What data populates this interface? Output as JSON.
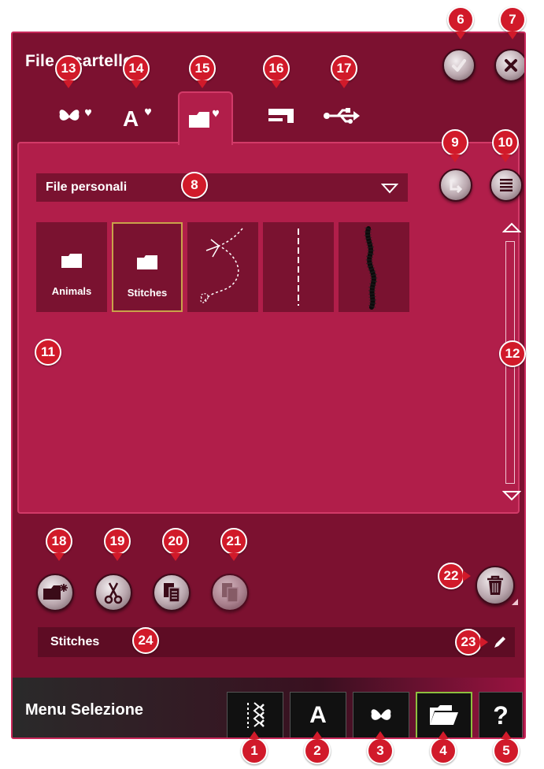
{
  "window": {
    "title": "File e cartelle"
  },
  "header": {
    "confirm_icon": "check-icon",
    "close_icon": "close-icon"
  },
  "tabs": [
    {
      "icon": "butterfly-heart-icon"
    },
    {
      "icon": "font-heart-icon"
    },
    {
      "icon": "folder-heart-icon",
      "active": true
    },
    {
      "icon": "machine-icon"
    },
    {
      "icon": "usb-icon"
    }
  ],
  "browser": {
    "dropdown_value": "File personali",
    "tiles": [
      {
        "type": "folder",
        "label": "Animals"
      },
      {
        "type": "folder",
        "label": "Stitches",
        "selected": true
      },
      {
        "type": "stitch",
        "label": ""
      },
      {
        "type": "stitch",
        "label": ""
      },
      {
        "type": "stitch",
        "label": ""
      }
    ]
  },
  "actions": {
    "new_folder_icon": "new-folder-icon",
    "cut_icon": "scissors-icon",
    "copy_icon": "copy-icon",
    "paste_icon": "paste-icon",
    "delete_icon": "trash-icon"
  },
  "name_field": {
    "value": "Stitches"
  },
  "bottom_bar": {
    "label": "Menu Selezione",
    "buttons": [
      {
        "icon": "stitch-icon"
      },
      {
        "text": "A"
      },
      {
        "icon": "butterfly-icon"
      },
      {
        "icon": "folder-open-icon",
        "active": true
      },
      {
        "text": "?"
      }
    ]
  },
  "callouts": [
    "1",
    "2",
    "3",
    "4",
    "5",
    "6",
    "7",
    "8",
    "9",
    "10",
    "11",
    "12",
    "13",
    "14",
    "15",
    "16",
    "17",
    "18",
    "19",
    "20",
    "21",
    "22",
    "23",
    "24"
  ],
  "colors": {
    "accent": "#b11e4a",
    "dark": "#7c1130",
    "callout": "#d11a2a",
    "selection": "#c9a24a",
    "active_nav": "#8dbf3f"
  }
}
